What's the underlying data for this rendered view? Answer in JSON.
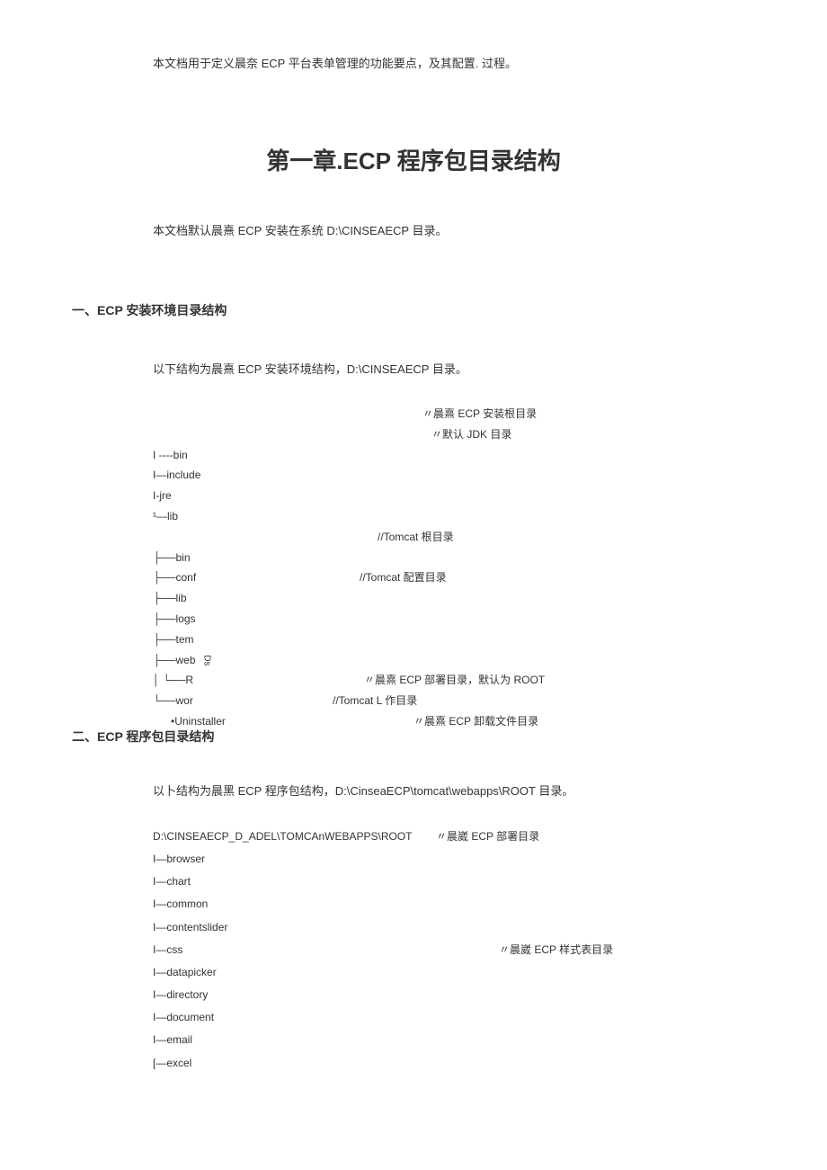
{
  "intro": "本文档用于定义晨奈 ECP 平台表单管理的功能要点，及其配置. 过程。",
  "chapter_title": "第一章.ECP 程序包目录结构",
  "subtitle": "本文档默认晨熹 ECP 安装在系统 D:\\CINSEAECP 目录。",
  "section1": {
    "title": "一、ECP 安装环境目录结构",
    "desc": "以下结构为晨熹 ECP 安装环境结构，D:\\CINSEAECP 目录。",
    "tree": [
      {
        "label": "",
        "comment": "〃晨熹 ECP 安装根目录"
      },
      {
        "label": "",
        "comment": "〃默认 JDK 目录"
      },
      {
        "label": "I ----bin",
        "comment": ""
      },
      {
        "label": "I—include",
        "comment": ""
      },
      {
        "label": "I-jre",
        "comment": ""
      },
      {
        "label": "¹—lib",
        "comment": ""
      },
      {
        "label": "",
        "comment": "//Tomcat 根目录"
      },
      {
        "label": "├──bin",
        "comment": ""
      },
      {
        "label": "├──conf",
        "comment": "//Tomcat 配置目录"
      },
      {
        "label": "├──lib",
        "comment": ""
      },
      {
        "label": "├──logs",
        "comment": ""
      },
      {
        "label": "├──tem",
        "comment": ""
      },
      {
        "label": "├──web",
        "side": "Ds",
        "comment": ""
      },
      {
        "label": "│ └──R",
        "comment": "〃晨熹 ECP 部署目录，默认为 ROOT"
      },
      {
        "label": "└──wor",
        "comment": "//Tomcat L 作目录"
      },
      {
        "label": "•Uninstaller",
        "comment": "〃晨熹 ECP 卸载文件目录"
      }
    ]
  },
  "section2": {
    "title": "二、ECP 程序包目录结构",
    "desc": "以卜结构为晨黑 ECP 程序包结构，D:\\CinseaECP\\tomcat\\webapps\\ROOT 目录。",
    "tree": [
      {
        "label": "D:\\CINSEAECP_D_ADEL\\TOMCAnWEBAPPS\\ROOT",
        "comment": "〃晨崴 ECP 部署目录"
      },
      {
        "label": "I—browser",
        "comment": ""
      },
      {
        "label": "I—chart",
        "comment": ""
      },
      {
        "label": "I—common",
        "comment": ""
      },
      {
        "label": "I—contentslider",
        "comment": ""
      },
      {
        "label": "I—css",
        "comment": "〃晨崴 ECP 样式表目录"
      },
      {
        "label": "I—datapicker",
        "comment": ""
      },
      {
        "label": "I—directory",
        "comment": ""
      },
      {
        "label": "I—document",
        "comment": ""
      },
      {
        "label": "I—email",
        "comment": ""
      },
      {
        "label": "[—excel",
        "comment": ""
      }
    ]
  }
}
